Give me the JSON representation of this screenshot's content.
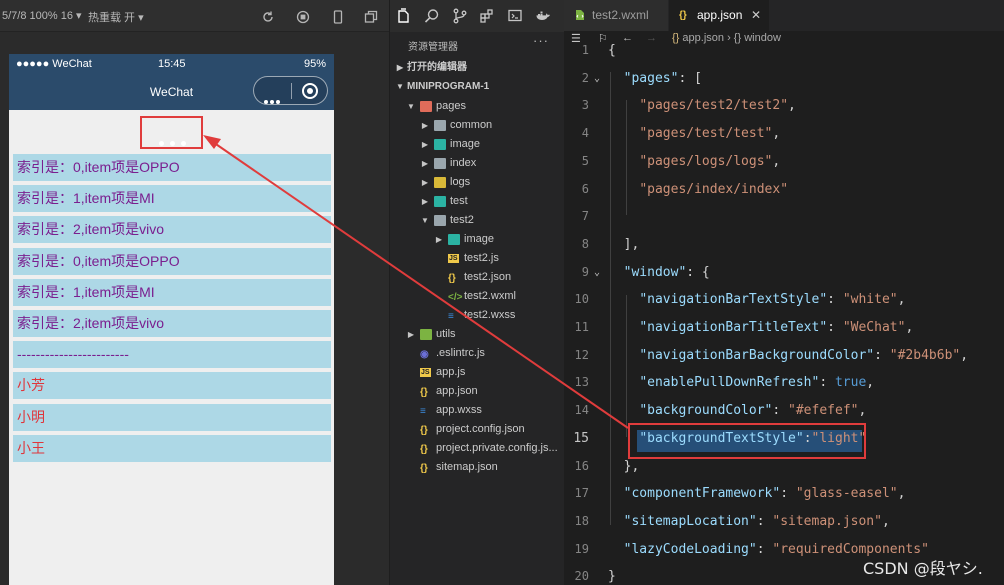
{
  "simulator": {
    "toolbar": {
      "device_info": "5/7/8 100% 16 ▾",
      "hot_reload": "热重载 开 ▾"
    },
    "status_bar": {
      "signal": "●●●●● WeChat",
      "time": "15:45",
      "battery": "95%"
    },
    "nav_bar": {
      "title": "WeChat",
      "background": "#2b4b6b"
    },
    "list": [
      {
        "text": "索引是：0,item项是OPPO",
        "color": "purple"
      },
      {
        "text": "索引是：1,item项是MI",
        "color": "purple"
      },
      {
        "text": "索引是：2,item项是vivo",
        "color": "purple"
      },
      {
        "text": "索引是：0,item项是OPPO",
        "color": "purple"
      },
      {
        "text": "索引是：1,item项是MI",
        "color": "purple"
      },
      {
        "text": "索引是：2,item项是vivo",
        "color": "purple"
      },
      {
        "text": "------------------------",
        "color": "purple"
      },
      {
        "text": "小芳",
        "color": "red"
      },
      {
        "text": "小明",
        "color": "red"
      },
      {
        "text": "小王",
        "color": "red"
      }
    ]
  },
  "explorer": {
    "title": "资源管理器",
    "more": "···",
    "open_editors": "打开的编辑器",
    "project": "MINIPROGRAM-1",
    "tree": [
      {
        "label": "pages",
        "type": "folder-red",
        "depth": 1,
        "expanded": true
      },
      {
        "label": "common",
        "type": "folder",
        "depth": 2,
        "expanded": false
      },
      {
        "label": "image",
        "type": "folder-teal",
        "depth": 2,
        "expanded": false
      },
      {
        "label": "index",
        "type": "folder",
        "depth": 2,
        "expanded": false
      },
      {
        "label": "logs",
        "type": "folder-yellow",
        "depth": 2,
        "expanded": false
      },
      {
        "label": "test",
        "type": "folder-teal",
        "depth": 2,
        "expanded": false
      },
      {
        "label": "test2",
        "type": "folder",
        "depth": 2,
        "expanded": true
      },
      {
        "label": "image",
        "type": "folder-teal",
        "depth": 3,
        "expanded": false
      },
      {
        "label": "test2.js",
        "type": "js",
        "depth": 3
      },
      {
        "label": "test2.json",
        "type": "json",
        "depth": 3
      },
      {
        "label": "test2.wxml",
        "type": "wxml",
        "depth": 3
      },
      {
        "label": "test2.wxss",
        "type": "wxss",
        "depth": 3
      },
      {
        "label": "utils",
        "type": "folder-green",
        "depth": 1,
        "expanded": false
      },
      {
        "label": ".eslintrc.js",
        "type": "eslint",
        "depth": 1
      },
      {
        "label": "app.js",
        "type": "js",
        "depth": 1
      },
      {
        "label": "app.json",
        "type": "json",
        "depth": 1
      },
      {
        "label": "app.wxss",
        "type": "wxss",
        "depth": 1
      },
      {
        "label": "project.config.json",
        "type": "json",
        "depth": 1
      },
      {
        "label": "project.private.config.js...",
        "type": "json",
        "depth": 1
      },
      {
        "label": "sitemap.json",
        "type": "json",
        "depth": 1
      }
    ]
  },
  "editor": {
    "tabs": [
      {
        "label": "test2.wxml",
        "active": false
      },
      {
        "label": "app.json",
        "active": true,
        "close": "✕"
      }
    ],
    "breadcrumb": {
      "file": "app.json",
      "sep": " › ",
      "symbol_icon": "{}",
      "symbol": "window"
    },
    "lines": [
      {
        "n": "1",
        "tokens": [
          [
            "p",
            "{"
          ]
        ]
      },
      {
        "n": "2",
        "tokens": [
          [
            "p",
            "  "
          ],
          [
            "k",
            "\"pages\""
          ],
          [
            "p",
            ": ["
          ]
        ]
      },
      {
        "n": "3",
        "tokens": [
          [
            "p",
            "    "
          ],
          [
            "s",
            "\"pages/test2/test2\""
          ],
          [
            "p",
            ","
          ]
        ]
      },
      {
        "n": "4",
        "tokens": [
          [
            "p",
            "    "
          ],
          [
            "s",
            "\"pages/test/test\""
          ],
          [
            "p",
            ","
          ]
        ]
      },
      {
        "n": "5",
        "tokens": [
          [
            "p",
            "    "
          ],
          [
            "s",
            "\"pages/logs/logs\""
          ],
          [
            "p",
            ","
          ]
        ]
      },
      {
        "n": "6",
        "tokens": [
          [
            "p",
            "    "
          ],
          [
            "s",
            "\"pages/index/index\""
          ]
        ]
      },
      {
        "n": "7",
        "tokens": []
      },
      {
        "n": "8",
        "tokens": [
          [
            "p",
            "  ],"
          ]
        ]
      },
      {
        "n": "9",
        "tokens": [
          [
            "p",
            "  "
          ],
          [
            "k",
            "\"window\""
          ],
          [
            "p",
            ": {"
          ]
        ]
      },
      {
        "n": "10",
        "tokens": [
          [
            "p",
            "    "
          ],
          [
            "k",
            "\"navigationBarTextStyle\""
          ],
          [
            "p",
            ": "
          ],
          [
            "s",
            "\"white\""
          ],
          [
            "p",
            ","
          ]
        ]
      },
      {
        "n": "11",
        "tokens": [
          [
            "p",
            "    "
          ],
          [
            "k",
            "\"navigationBarTitleText\""
          ],
          [
            "p",
            ": "
          ],
          [
            "s",
            "\"WeChat\""
          ],
          [
            "p",
            ","
          ]
        ]
      },
      {
        "n": "12",
        "tokens": [
          [
            "p",
            "    "
          ],
          [
            "k",
            "\"navigationBarBackgroundColor\""
          ],
          [
            "p",
            ": "
          ],
          [
            "s",
            "\"#2b4b6b\""
          ],
          [
            "p",
            ","
          ]
        ]
      },
      {
        "n": "13",
        "tokens": [
          [
            "p",
            "    "
          ],
          [
            "k",
            "\"enablePullDownRefresh\""
          ],
          [
            "p",
            ": "
          ],
          [
            "b",
            "true"
          ],
          [
            "p",
            ","
          ]
        ]
      },
      {
        "n": "14",
        "tokens": [
          [
            "p",
            "    "
          ],
          [
            "k",
            "\"backgroundColor\""
          ],
          [
            "p",
            ": "
          ],
          [
            "s",
            "\"#efefef\""
          ],
          [
            "p",
            ","
          ]
        ]
      },
      {
        "n": "15",
        "tokens": [
          [
            "p",
            "    "
          ],
          [
            "k",
            "\"backgroundTextStyle\""
          ],
          [
            "p",
            ":"
          ],
          [
            "s",
            "\"light\""
          ]
        ]
      },
      {
        "n": "16",
        "tokens": [
          [
            "p",
            "  },"
          ]
        ]
      },
      {
        "n": "17",
        "tokens": [
          [
            "p",
            "  "
          ],
          [
            "k",
            "\"componentFramework\""
          ],
          [
            "p",
            ": "
          ],
          [
            "s",
            "\"glass-easel\""
          ],
          [
            "p",
            ","
          ]
        ]
      },
      {
        "n": "18",
        "tokens": [
          [
            "p",
            "  "
          ],
          [
            "k",
            "\"sitemapLocation\""
          ],
          [
            "p",
            ": "
          ],
          [
            "s",
            "\"sitemap.json\""
          ],
          [
            "p",
            ","
          ]
        ]
      },
      {
        "n": "19",
        "tokens": [
          [
            "p",
            "  "
          ],
          [
            "k",
            "\"lazyCodeLoading\""
          ],
          [
            "p",
            ": "
          ],
          [
            "s",
            "\"requiredComponents\""
          ]
        ]
      },
      {
        "n": "20",
        "tokens": [
          [
            "p",
            "}"
          ]
        ]
      }
    ],
    "current_line": "15",
    "watermark": "CSDN @段ヤシ."
  },
  "colors": {
    "annotation": "#e03c3c",
    "list_bg": "#add8e6",
    "nav": "#2b4b6b"
  }
}
